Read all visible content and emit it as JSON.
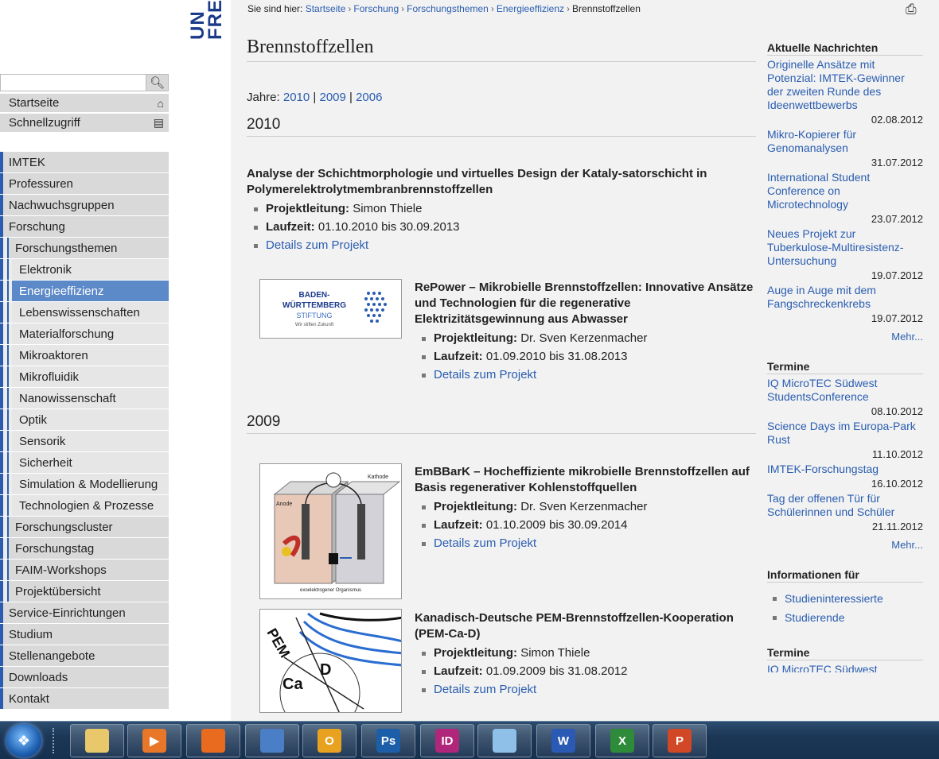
{
  "logo": {
    "line1": "UN",
    "line2": "FRE"
  },
  "search": {
    "placeholder": ""
  },
  "quick_nav": [
    {
      "label": "Startseite",
      "icon": "home-icon"
    },
    {
      "label": "Schnellzugriff",
      "icon": "shortcut-icon"
    }
  ],
  "nav": [
    {
      "label": "IMTEK",
      "level": 1
    },
    {
      "label": "Professuren",
      "level": 1
    },
    {
      "label": "Nachwuchsgruppen",
      "level": 1
    },
    {
      "label": "Forschung",
      "level": 1
    },
    {
      "label": "Forschungsthemen",
      "level": 2
    },
    {
      "label": "Elektronik",
      "level": 3
    },
    {
      "label": "Energieeffizienz",
      "level": 3,
      "active": true
    },
    {
      "label": "Lebenswissenschaften",
      "level": 3
    },
    {
      "label": "Materialforschung",
      "level": 3
    },
    {
      "label": "Mikroaktoren",
      "level": 3
    },
    {
      "label": "Mikrofluidik",
      "level": 3
    },
    {
      "label": "Nanowissenschaft",
      "level": 3
    },
    {
      "label": "Optik",
      "level": 3
    },
    {
      "label": "Sensorik",
      "level": 3
    },
    {
      "label": "Sicherheit",
      "level": 3
    },
    {
      "label": "Simulation & Modellierung",
      "level": 3
    },
    {
      "label": "Technologien & Prozesse",
      "level": 3
    },
    {
      "label": "Forschungscluster",
      "level": 2
    },
    {
      "label": "Forschungstag",
      "level": 2
    },
    {
      "label": "FAIM-Workshops",
      "level": 2
    },
    {
      "label": "Projektübersicht",
      "level": 2
    },
    {
      "label": "Service-Einrichtungen",
      "level": 1
    },
    {
      "label": "Studium",
      "level": 1
    },
    {
      "label": "Stellenangebote",
      "level": 1
    },
    {
      "label": "Downloads",
      "level": 1
    },
    {
      "label": "Kontakt",
      "level": 1
    }
  ],
  "breadcrumb": {
    "prefix": "Sie sind hier:",
    "items": [
      "Startseite",
      "Forschung",
      "Forschungsthemen",
      "Energieeffizienz"
    ],
    "current": "Brennstoffzellen"
  },
  "page_title": "Brennstoffzellen",
  "years_label": "Jahre:",
  "years": [
    "2010",
    "2009",
    "2006"
  ],
  "sections": [
    {
      "year": "2010",
      "projects": [
        {
          "title": "Analyse der Schichtmorphologie und virtuelles Design der Kataly-satorschicht in Polymerelektrolytmembranbrennstoffzellen",
          "lead_label": "Projektleitung:",
          "lead": "Simon Thiele",
          "duration_label": "Laufzeit:",
          "duration": "01.10.2010 bis 30.09.2013",
          "details": "Details zum Projekt"
        },
        {
          "title": "RePower – Mikrobielle Brennstoffzellen: Innovative Ansätze und Technologien für die regenerative Elektrizitätsgewinnung aus Abwasser",
          "lead_label": "Projektleitung:",
          "lead": "Dr. Sven Kerzenmacher",
          "duration_label": "Laufzeit:",
          "duration": "01.09.2010 bis 31.08.2013",
          "details": "Details zum Projekt",
          "thumb": {
            "line1": "BADEN-",
            "line2": "WÜRTTEMBERG",
            "line3": "STIFTUNG",
            "line4": "Wir stiften Zukunft"
          }
        }
      ]
    },
    {
      "year": "2009",
      "projects": [
        {
          "title": "EmBBarK – Hocheffiziente mikrobielle Brennstoffzellen auf Basis regenerativer Kohlenstoffquellen",
          "lead_label": "Projektleitung:",
          "lead": "Dr. Sven Kerzenmacher",
          "duration_label": "Laufzeit:",
          "duration": "01.10.2009 bis 30.09.2014",
          "details": "Details zum Projekt",
          "thumb": {
            "anode": "Anode",
            "kathode": "Kathode",
            "organism": "exoelektrogener Organismus"
          }
        },
        {
          "title": "Kanadisch-Deutsche PEM-Brennstoffzellen-Kooperation (PEM-Ca-D)",
          "lead_label": "Projektleitung:",
          "lead": "Simon Thiele",
          "duration_label": "Laufzeit:",
          "duration": "01.09.2009 bis 31.08.2012",
          "details": "Details zum Projekt",
          "thumb": {
            "pem": "PEM",
            "ca": "Ca",
            "d": "D"
          }
        }
      ]
    }
  ],
  "news": {
    "heading": "Aktuelle Nachrichten",
    "items": [
      {
        "title": "Originelle Ansätze mit Potenzial: IMTEK-Gewinner der zweiten Runde des Ideenwettbewerbs",
        "date": "02.08.2012"
      },
      {
        "title": "Mikro-Kopierer für Genomanalysen",
        "date": "31.07.2012"
      },
      {
        "title": "International Student Conference on Microtechnology",
        "date": "23.07.2012"
      },
      {
        "title": "Neues Projekt zur Tuberkulose-Multiresistenz-Untersuchung",
        "date": "19.07.2012"
      },
      {
        "title": "Auge in Auge mit dem Fangschreckenkrebs",
        "date": "19.07.2012"
      }
    ],
    "more": "Mehr..."
  },
  "events": {
    "heading": "Termine",
    "items": [
      {
        "title": "IQ MicroTEC Südwest StudentsConference",
        "date": "08.10.2012"
      },
      {
        "title": "Science Days im Europa-Park Rust",
        "date": "11.10.2012"
      },
      {
        "title": "IMTEK-Forschungstag",
        "date": "16.10.2012"
      },
      {
        "title": "Tag der offenen Tür für Schülerinnen und Schüler",
        "date": "21.11.2012"
      }
    ],
    "more": "Mehr..."
  },
  "info": {
    "heading": "Informationen für",
    "items": [
      "Studieninteressierte",
      "Studierende"
    ]
  },
  "events2": {
    "heading": "Termine",
    "first": "IQ MicroTEC Südwest"
  },
  "taskbar": {
    "apps": [
      {
        "name": "explorer-icon",
        "label": "",
        "color": "#e8c86a"
      },
      {
        "name": "media-player-icon",
        "label": "▶",
        "color": "#e8772a"
      },
      {
        "name": "firefox-icon",
        "label": "",
        "color": "#e86b1f"
      },
      {
        "name": "thunderbird-icon",
        "label": "",
        "color": "#4a7fc8"
      },
      {
        "name": "outlook-icon",
        "label": "O",
        "color": "#e8a21f"
      },
      {
        "name": "photoshop-icon",
        "label": "Ps",
        "color": "#1c5ea8"
      },
      {
        "name": "indesign-icon",
        "label": "ID",
        "color": "#b0267a"
      },
      {
        "name": "notepad-icon",
        "label": "",
        "color": "#8fc0e8"
      },
      {
        "name": "word-icon",
        "label": "W",
        "color": "#2b5ab5"
      },
      {
        "name": "excel-icon",
        "label": "X",
        "color": "#2e8b3a"
      },
      {
        "name": "powerpoint-icon",
        "label": "P",
        "color": "#d24726"
      }
    ]
  }
}
